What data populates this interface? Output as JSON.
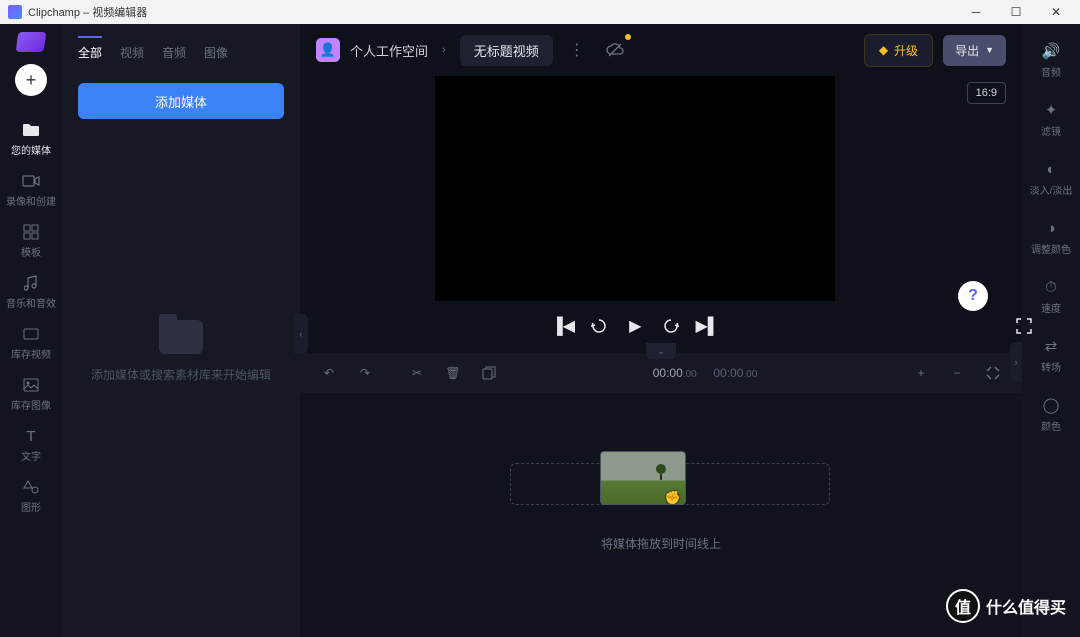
{
  "window": {
    "title": "Clipchamp – 视频编辑器"
  },
  "leftnav": {
    "items": [
      {
        "label": "您的媒体"
      },
      {
        "label": "录像和创建"
      },
      {
        "label": "模板"
      },
      {
        "label": "音乐和音效"
      },
      {
        "label": "库存视频"
      },
      {
        "label": "库存图像"
      },
      {
        "label": "文字"
      },
      {
        "label": "图形"
      }
    ]
  },
  "mediapanel": {
    "tabs": [
      {
        "label": "全部"
      },
      {
        "label": "视频"
      },
      {
        "label": "音频"
      },
      {
        "label": "图像"
      }
    ],
    "add_media": "添加媒体",
    "empty_hint": "添加媒体或搜索素材库来开始编辑"
  },
  "topbar": {
    "workspace": "个人工作空间",
    "project_name": "无标题视频",
    "upgrade": "升级",
    "export": "导出",
    "aspect": "16:9"
  },
  "timecode": {
    "current": "00:00",
    "current_sub": ".00",
    "total": "00:00",
    "total_sub": ".00"
  },
  "timeline": {
    "drop_hint": "将媒体拖放到时间线上"
  },
  "rightnav": {
    "items": [
      {
        "label": "音频"
      },
      {
        "label": "滤镜"
      },
      {
        "label": "淡入/淡出"
      },
      {
        "label": "调整颜色"
      },
      {
        "label": "速度"
      },
      {
        "label": "转场"
      },
      {
        "label": "颜色"
      }
    ]
  },
  "watermark": {
    "text": "什么值得买",
    "badge": "值"
  }
}
